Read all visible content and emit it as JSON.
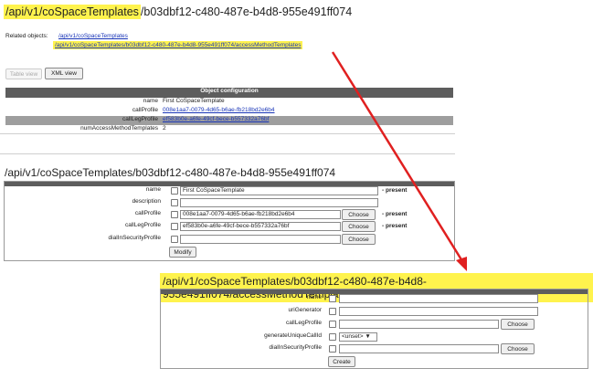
{
  "page1": {
    "title_highlighted": "/api/v1/coSpaceTemplates",
    "title_rest": "/b03dbf12-c480-487e-b4d8-955e491ff074",
    "related_label": "Related objects:",
    "related_links": [
      "/api/v1/coSpaceTemplates",
      "/api/v1/coSpaceTemplates/b03dbf12-c480-487e-b4d8-955e491ff074/accessMethodTemplates"
    ],
    "view_buttons": [
      "Table view",
      "XML view"
    ]
  },
  "object_configuration": {
    "header": "Object configuration",
    "rows": [
      {
        "key": "name",
        "value": "First CoSpaceTemplate",
        "link": false
      },
      {
        "key": "callProfile",
        "value": "008e1aa7-0079-4d65-b6ae-fb218bd2e6b4",
        "link": true
      },
      {
        "key": "callLegProfile",
        "value": "ef583b0e-a6fe-49cf-bece-b557332a76bf",
        "link": true
      },
      {
        "key": "numAccessMethodTemplates",
        "value": "2",
        "link": false
      }
    ]
  },
  "edit_form": {
    "title": "/api/v1/coSpaceTemplates/b03dbf12-c480-487e-b4d8-955e491ff074",
    "rows": [
      {
        "label": "name",
        "value": "First CoSpaceTemplate",
        "choose": "",
        "present": "- present"
      },
      {
        "label": "description",
        "value": "",
        "choose": "",
        "present": ""
      },
      {
        "label": "callProfile",
        "value": "008e1aa7-0079-4d65-b6ae-fb218bd2e6b4",
        "choose": "Choose",
        "present": "- present"
      },
      {
        "label": "callLegProfile",
        "value": "ef583b0e-a6fe-49cf-bece-b557332a76bf",
        "choose": "Choose",
        "present": "- present"
      },
      {
        "label": "dialInSecurityProfile",
        "value": "",
        "choose": "Choose",
        "present": ""
      }
    ],
    "submit": "Modify"
  },
  "access_form": {
    "title": "/api/v1/coSpaceTemplates/b03dbf12-c480-487e-b4d8-955e491ff074/accessMethodTemplates",
    "rows": [
      {
        "label": "name",
        "type": "text",
        "choose": ""
      },
      {
        "label": "uriGenerator",
        "type": "text",
        "choose": ""
      },
      {
        "label": "callLegProfile",
        "type": "text",
        "choose": "Choose"
      },
      {
        "label": "generateUniqueCallId",
        "type": "select",
        "choose": "",
        "selected": "<unset>"
      },
      {
        "label": "dialInSecurityProfile",
        "type": "text",
        "choose": "Choose"
      }
    ],
    "submit": "Create"
  },
  "colors": {
    "highlight": "#fff34d",
    "arrow": "#e02020",
    "table_header": "#5d5d5d",
    "link": "#1a36b8"
  }
}
